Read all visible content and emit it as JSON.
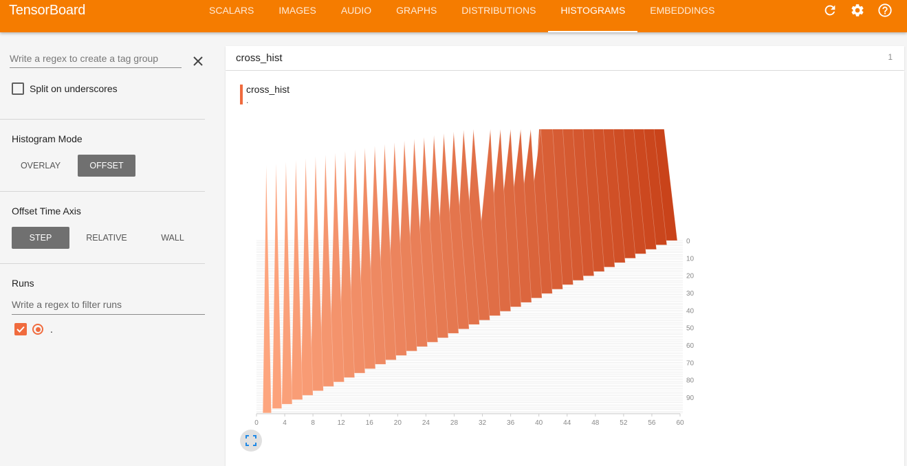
{
  "app": {
    "title": "TensorBoard"
  },
  "tabs": [
    {
      "label": "SCALARS",
      "active": false
    },
    {
      "label": "IMAGES",
      "active": false
    },
    {
      "label": "AUDIO",
      "active": false
    },
    {
      "label": "GRAPHS",
      "active": false
    },
    {
      "label": "DISTRIBUTIONS",
      "active": false
    },
    {
      "label": "HISTOGRAMS",
      "active": true
    },
    {
      "label": "EMBEDDINGS",
      "active": false
    }
  ],
  "toolbar": {
    "icons": [
      "refresh-icon",
      "settings-icon",
      "help-icon"
    ]
  },
  "sidebar": {
    "tag_regex": {
      "placeholder": "Write a regex to create a tag group",
      "value": ""
    },
    "split_label": "Split on underscores",
    "split_checked": false,
    "histogram_mode": {
      "title": "Histogram Mode",
      "options": [
        "OVERLAY",
        "OFFSET"
      ],
      "selected": "OFFSET"
    },
    "offset_axis": {
      "title": "Offset Time Axis",
      "options": [
        "STEP",
        "RELATIVE",
        "WALL"
      ],
      "selected": "STEP"
    },
    "runs": {
      "title": "Runs",
      "filter": {
        "placeholder": "Write a regex to filter runs",
        "value": ""
      },
      "items": [
        {
          "label": ".",
          "checked": true,
          "color": "#f06b3e"
        }
      ]
    }
  },
  "main": {
    "group_title": "cross_hist",
    "group_count": "1",
    "card": {
      "tag": "cross_hist",
      "run": "."
    }
  },
  "chart_data": {
    "type": "area",
    "title": "cross_hist",
    "series_name": ".",
    "x_ticks": [
      0,
      4,
      8,
      12,
      16,
      20,
      24,
      28,
      32,
      36,
      40,
      44,
      48,
      52,
      56,
      60
    ],
    "xlim": [
      0,
      60
    ],
    "offset_ticks": [
      0,
      10,
      20,
      30,
      40,
      50,
      60,
      70,
      80,
      90
    ],
    "offset_axis": "step",
    "mode": "offset",
    "colors": {
      "early": "#fda57e",
      "late": "#c9431a"
    }
  }
}
